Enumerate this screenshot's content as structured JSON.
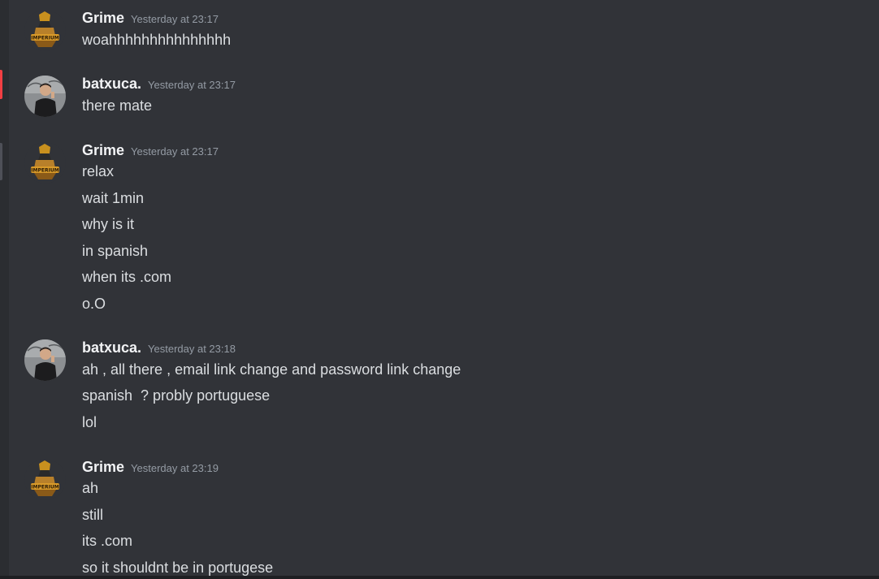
{
  "messages": [
    {
      "author": "Grime",
      "avatar": "grime-logo-avatar",
      "timestamp": "Yesterday at 23:17",
      "lines": [
        "woahhhhhhhhhhhhhhh"
      ]
    },
    {
      "author": "batxuca.",
      "avatar": "batxuca-photo-avatar",
      "timestamp": "Yesterday at 23:17",
      "lines": [
        "there mate"
      ]
    },
    {
      "author": "Grime",
      "avatar": "grime-logo-avatar",
      "timestamp": "Yesterday at 23:17",
      "lines": [
        "relax",
        "wait 1min",
        "why is it",
        "in spanish",
        "when its .com",
        "o.O"
      ]
    },
    {
      "author": "batxuca.",
      "avatar": "batxuca-photo-avatar",
      "timestamp": "Yesterday at 23:18",
      "lines": [
        "ah , all there , email link change and password link change",
        "spanish  ? probly portuguese",
        "lol"
      ]
    },
    {
      "author": "Grime",
      "avatar": "grime-logo-avatar",
      "timestamp": "Yesterday at 23:19",
      "lines": [
        "ah",
        "still",
        "its .com",
        "so it shouldnt be in portugese"
      ]
    }
  ],
  "colors": {
    "background": "#313338",
    "username": "#f2f3f5",
    "timestamp": "#949ba4",
    "message_text": "#dbdee1",
    "unread_marker": "#f23f43"
  }
}
